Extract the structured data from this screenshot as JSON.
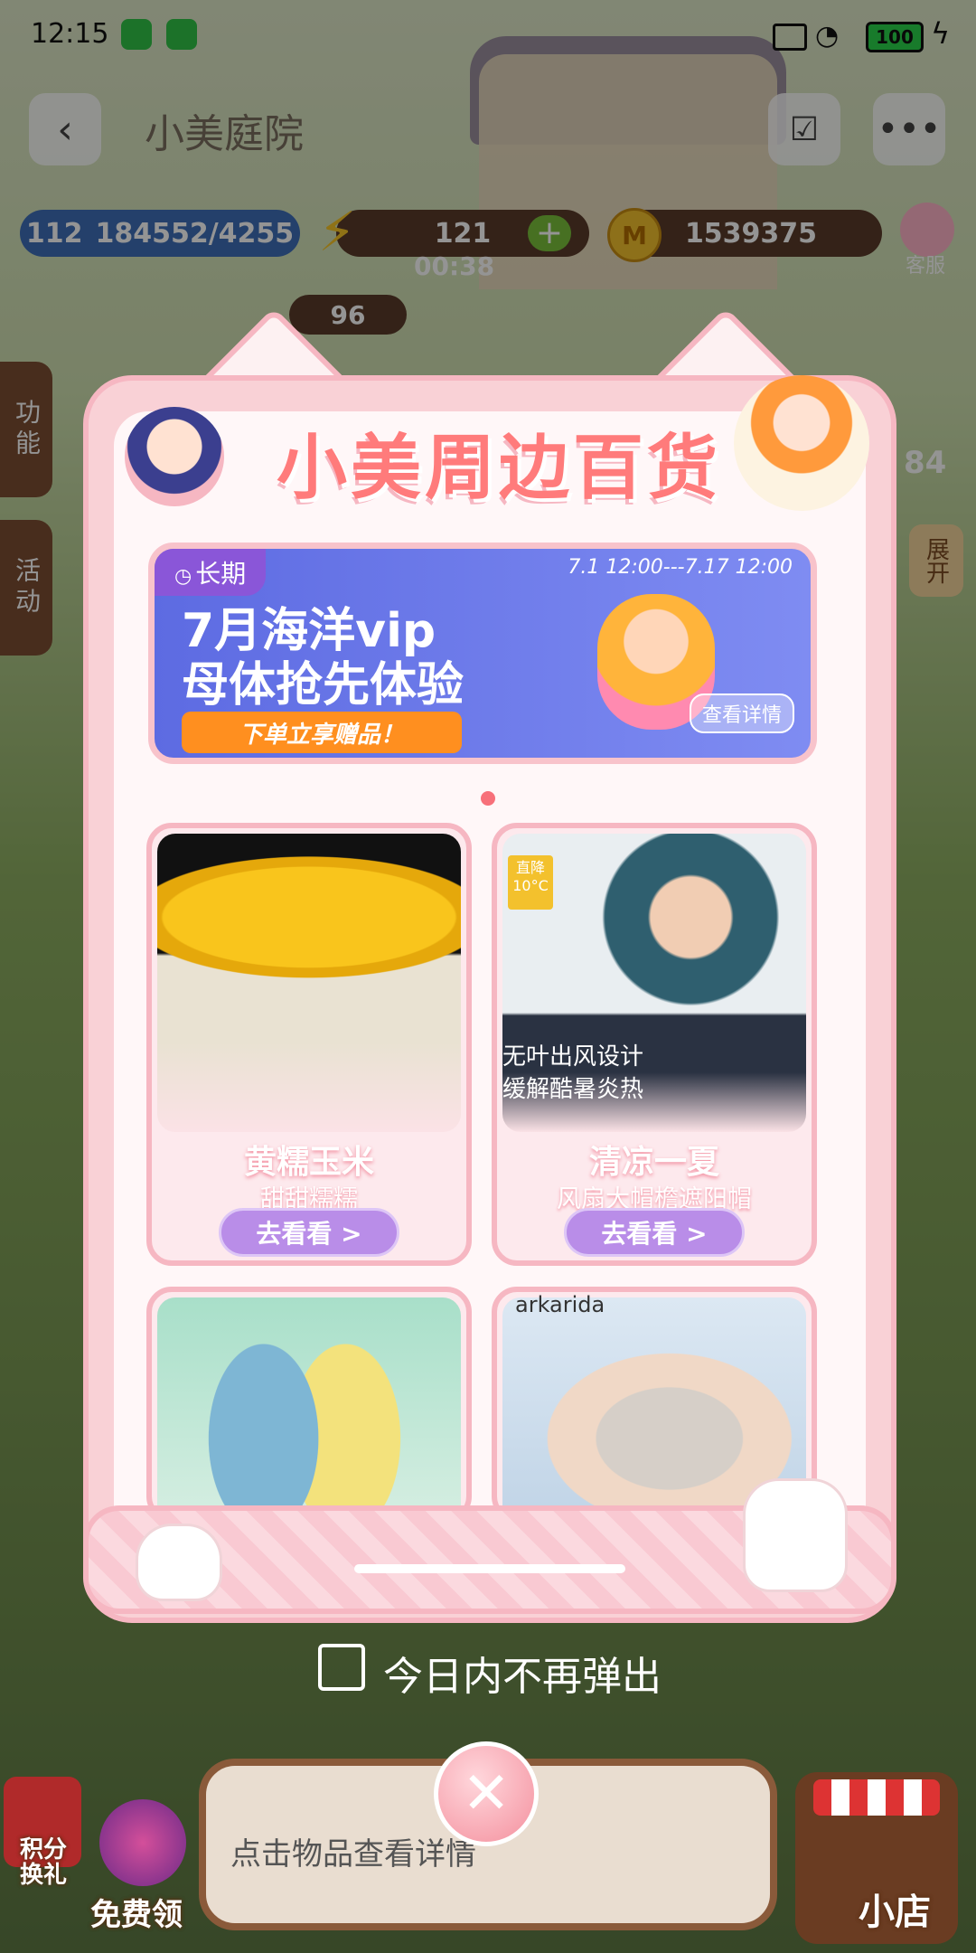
{
  "status_bar": {
    "time": "12:15",
    "battery": "100"
  },
  "header": {
    "title": "小美庭院"
  },
  "resources": {
    "level": "112",
    "exp": "184552/4255",
    "energy": "121",
    "energy_timer": "00:38",
    "coins": "1539375",
    "service_label": "客服",
    "plot_coin": "96"
  },
  "side_tabs": {
    "function": "功能",
    "activity": "活动",
    "expand": "展开",
    "side_number": "84"
  },
  "popup": {
    "title": "小美周边百货",
    "banner": {
      "tag": "长期",
      "date_range": "7.1 12:00---7.17 12:00",
      "line1": "7月海洋vip",
      "line2": "母体抢先体验",
      "cta": "下单立享赠品！",
      "detail": "查看详情"
    },
    "products": [
      {
        "title": "黄糯玉米",
        "subtitle": "甜甜糯糯",
        "button": "去看看 >",
        "image_colors": [
          "#f5c21b",
          "#e0a800"
        ]
      },
      {
        "title": "清凉一夏",
        "subtitle": "风扇大帽檐遮阳帽",
        "button": "去看看 >",
        "image_text": "无叶出风设计\n缓解酷暑炎热",
        "badge": "直降\n10°C",
        "image_colors": [
          "#b9d6e4",
          "#3e6b8a"
        ]
      },
      {
        "image_colors": [
          "#a8dfc9",
          "#f3e27c"
        ]
      },
      {
        "image_text": "arkarida",
        "image_colors": [
          "#dce8f3",
          "#c9c3bd"
        ]
      }
    ]
  },
  "dont_show_today": "今日内不再弹出",
  "bottom": {
    "info_text": "点击物品查看详情",
    "points_exchange": "积分\n换礼",
    "free_claim": "免费领",
    "shop": "小店"
  }
}
